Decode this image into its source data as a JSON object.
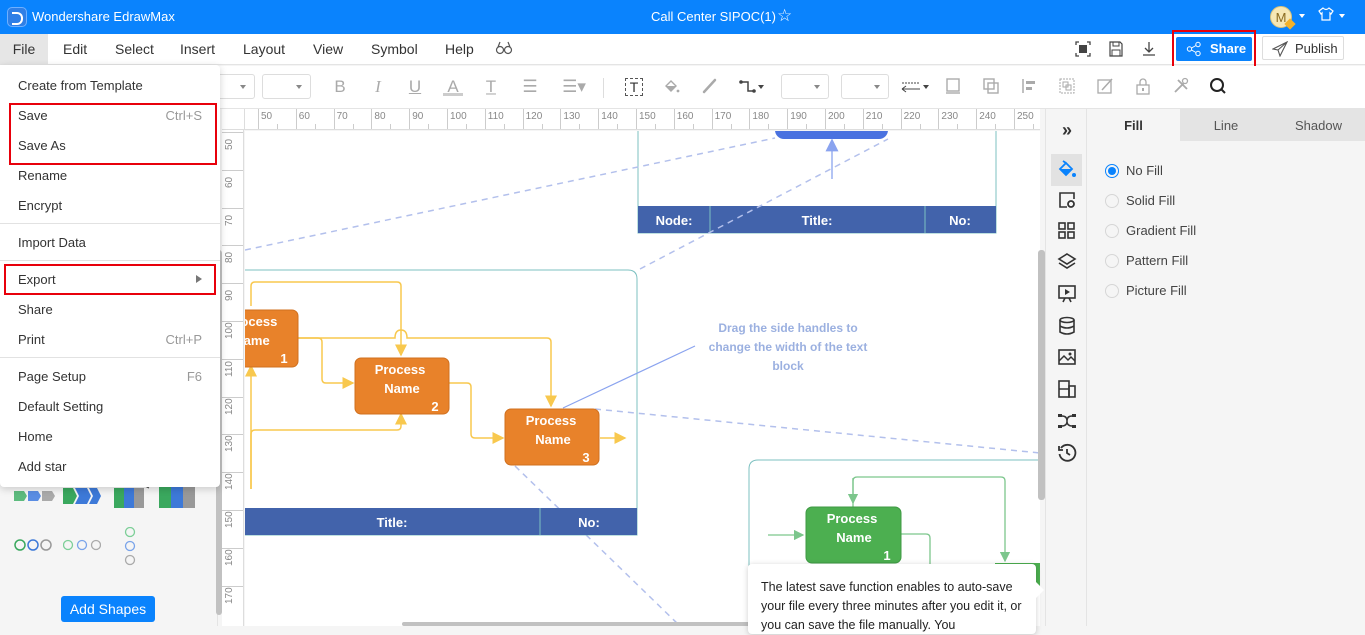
{
  "app": {
    "name": "Wondershare EdrawMax",
    "document_title": "Call Center SIPOC(1)",
    "avatar_initial": "M"
  },
  "menubar": {
    "items": [
      "File",
      "Edit",
      "Select",
      "Insert",
      "Layout",
      "View",
      "Symbol",
      "Help"
    ],
    "share_label": "Share",
    "publish_label": "Publish"
  },
  "file_menu": {
    "items": [
      {
        "label": "Create from Template",
        "shortcut": ""
      },
      {
        "label": "Save",
        "shortcut": "Ctrl+S"
      },
      {
        "label": "Save As",
        "shortcut": ""
      },
      {
        "label": "Rename",
        "shortcut": ""
      },
      {
        "label": "Encrypt",
        "shortcut": ""
      },
      {
        "label": "Import Data",
        "shortcut": ""
      },
      {
        "label": "Export",
        "shortcut": "",
        "submenu": true
      },
      {
        "label": "Share",
        "shortcut": ""
      },
      {
        "label": "Print",
        "shortcut": "Ctrl+P"
      },
      {
        "label": "Page Setup",
        "shortcut": "F6"
      },
      {
        "label": "Default Setting",
        "shortcut": ""
      },
      {
        "label": "Home",
        "shortcut": ""
      },
      {
        "label": "Add star",
        "shortcut": ""
      }
    ]
  },
  "left_panel": {
    "add_shapes_label": "Add Shapes"
  },
  "rulers": {
    "top": [
      "50",
      "60",
      "70",
      "80",
      "90",
      "100",
      "110",
      "120",
      "130",
      "140",
      "150",
      "160",
      "170",
      "180",
      "190",
      "200",
      "210",
      "220",
      "230",
      "240",
      "250"
    ],
    "left": [
      "50",
      "60",
      "70",
      "80",
      "90",
      "100",
      "110",
      "120",
      "130",
      "140",
      "150",
      "160",
      "170"
    ]
  },
  "canvas": {
    "process_boxes_orange": [
      {
        "line1": "Process",
        "line2": "Name",
        "number": "1"
      },
      {
        "line1": "Process",
        "line2": "Name",
        "number": "2"
      },
      {
        "line1": "Process",
        "line2": "Name",
        "number": "3"
      }
    ],
    "process_box_green": {
      "line1": "Process",
      "line2": "Name",
      "number": "1"
    },
    "top_footer": {
      "node": "Node:",
      "title": "Title:",
      "no": "No:"
    },
    "left_footer": {
      "title": "Title:",
      "no": "No:"
    },
    "hint_text": [
      "Drag the side handles to",
      "change the width of the text",
      "block"
    ],
    "colors": {
      "orange": "#e8822a",
      "green": "#4caf50",
      "footer_blue": "#4263ab",
      "connector_yellow": "#f8c84e"
    }
  },
  "properties": {
    "tabs": [
      "Fill",
      "Line",
      "Shadow"
    ],
    "active_tab": "Fill",
    "fill_options": [
      "No Fill",
      "Solid Fill",
      "Gradient Fill",
      "Pattern Fill",
      "Picture Fill"
    ],
    "selected_fill": "No Fill"
  },
  "tooltip": {
    "text": "The latest save function enables to  auto-save your file every three minutes after you edit it, or you can save the file manually. You"
  },
  "colors": {
    "brand_blue": "#0a83fd",
    "highlight_red": "#e8000b"
  }
}
